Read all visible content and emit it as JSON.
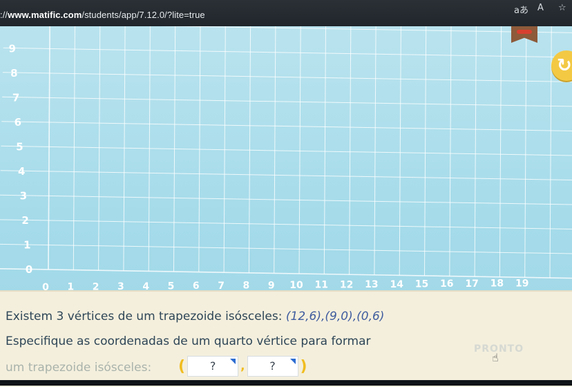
{
  "browser": {
    "url_prefix": "://",
    "url_host": "www.matific.com",
    "url_path": "/students/app/7.12.0/?lite=true",
    "icons": [
      "translate-icon",
      "read-aloud-icon",
      "favorite-star-icon"
    ],
    "translate_glyph": "aあ",
    "read_glyph": "A",
    "star_glyph": "☆"
  },
  "grid": {
    "x_ticks": [
      "0",
      "1",
      "2",
      "3",
      "4",
      "5",
      "6",
      "7",
      "8",
      "9",
      "10",
      "11",
      "12",
      "13",
      "14",
      "15",
      "16",
      "17",
      "18",
      "19"
    ],
    "y_ticks": [
      "0",
      "1",
      "2",
      "3",
      "4",
      "5",
      "6",
      "7",
      "8",
      "9"
    ]
  },
  "reset_glyph": "↻",
  "task": {
    "line1_prefix": "Existem 3 vértices de um trapezoide isósceles: ",
    "line1_coords": "(12,6),(9,0),(0,6)",
    "line2": "Especifique as coordenadas de um quarto vértice para formar",
    "line3": "um trapezoide isósceles:",
    "open_paren": "(",
    "close_paren": ")",
    "comma": ",",
    "input_x_placeholder": "?",
    "input_y_placeholder": "?"
  },
  "done_button": {
    "label": "PRONTO"
  },
  "colors": {
    "grid_bg": "#a5dbea",
    "grid_line": "#ffffff",
    "panel_bg": "#f4efdd",
    "tick_label": "#ffffff",
    "accent_yellow": "#f0bd20"
  }
}
